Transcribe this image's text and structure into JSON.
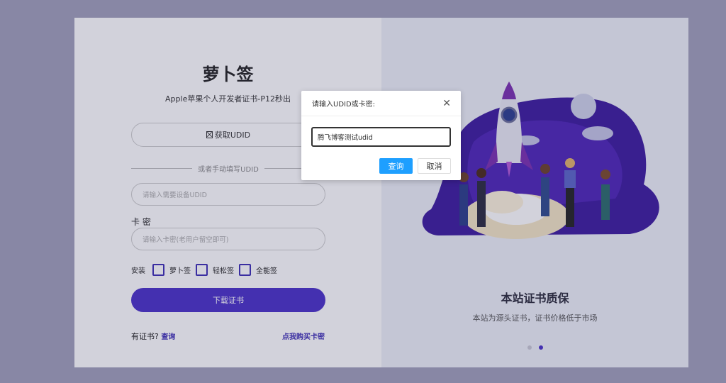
{
  "app": {
    "title": "萝卜签",
    "subtitle": "Apple苹果个人开发者证书-P12秒出"
  },
  "form": {
    "get_udid_label": "获取UDID",
    "divider_text": "或者手动填写UDID",
    "udid_placeholder": "请输入需要设备UDID",
    "card_label": "卡 密",
    "card_placeholder": "请输入卡密(老用户留空即可)",
    "install_label": "安装",
    "install_options": [
      "萝卜签",
      "轻松签",
      "全能签"
    ],
    "download_label": "下载证书",
    "has_cert_label": "有证书?",
    "query_link": "查询",
    "buy_link": "点我购买卡密"
  },
  "promo": {
    "title": "本站证书质保",
    "description": "本站为源头证书，证书价格低于市场",
    "carousel_active_index": 1
  },
  "dialog": {
    "title": "请输入UDID或卡密:",
    "input_value": "腾飞博客测试udid",
    "confirm_label": "查询",
    "cancel_label": "取消",
    "close_icon": "close-icon"
  },
  "colors": {
    "background": "#a09fba",
    "accent": "#4a30c8",
    "dialog_primary": "#1e9fff"
  }
}
